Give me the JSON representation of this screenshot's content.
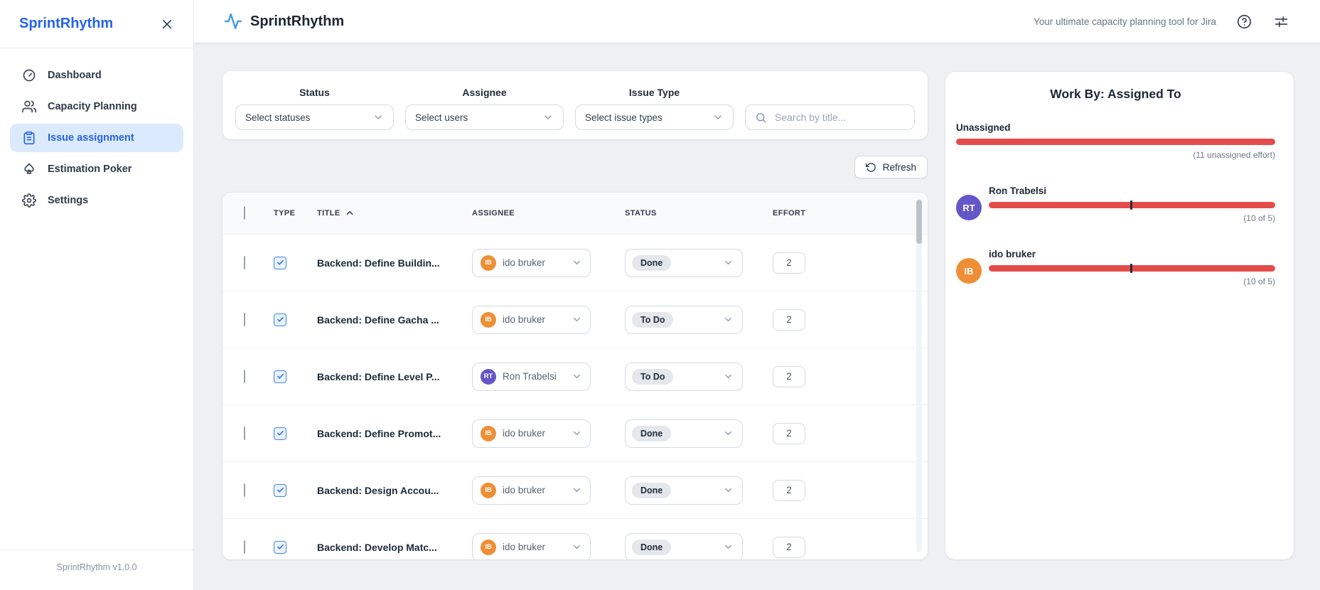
{
  "sidebar": {
    "title": "SprintRhythm",
    "items": [
      {
        "label": "Dashboard",
        "icon": "gauge-icon",
        "active": false
      },
      {
        "label": "Capacity Planning",
        "icon": "users-icon",
        "active": false
      },
      {
        "label": "Issue assignment",
        "icon": "clipboard-icon",
        "active": true
      },
      {
        "label": "Estimation Poker",
        "icon": "spade-icon",
        "active": false
      },
      {
        "label": "Settings",
        "icon": "gear-icon",
        "active": false
      }
    ],
    "footer": "SprintRhythm v1.0.0"
  },
  "topbar": {
    "brand": "SprintRhythm",
    "tagline": "Your ultimate capacity planning tool for Jira"
  },
  "filters": {
    "status_label": "Status",
    "status_value": "Select statuses",
    "assignee_label": "Assignee",
    "assignee_value": "Select users",
    "issue_type_label": "Issue Type",
    "issue_type_value": "Select issue types",
    "search_placeholder": "Search by title..."
  },
  "toolbar": {
    "refresh_label": "Refresh"
  },
  "table": {
    "headers": {
      "type": "TYPE",
      "title": "TITLE",
      "assignee": "ASSIGNEE",
      "status": "STATUS",
      "effort": "EFFORT"
    },
    "sort_column": "TITLE",
    "sort_direction": "ascending",
    "rows": [
      {
        "title": "Backend: Define Buildin...",
        "assignee": "ido bruker",
        "assignee_initials": "IB",
        "avatar_color": "#ee8f35",
        "status": "Done",
        "effort": "2"
      },
      {
        "title": "Backend: Define Gacha ...",
        "assignee": "ido bruker",
        "assignee_initials": "IB",
        "avatar_color": "#ee8f35",
        "status": "To Do",
        "effort": "2"
      },
      {
        "title": "Backend: Define Level P...",
        "assignee": "Ron Trabelsi",
        "assignee_initials": "RT",
        "avatar_color": "#6456c8",
        "status": "To Do",
        "effort": "2"
      },
      {
        "title": "Backend: Define Promot...",
        "assignee": "ido bruker",
        "assignee_initials": "IB",
        "avatar_color": "#ee8f35",
        "status": "Done",
        "effort": "2"
      },
      {
        "title": "Backend: Design Accou...",
        "assignee": "ido bruker",
        "assignee_initials": "IB",
        "avatar_color": "#ee8f35",
        "status": "Done",
        "effort": "2"
      },
      {
        "title": "Backend: Develop Matc...",
        "assignee": "ido bruker",
        "assignee_initials": "IB",
        "avatar_color": "#ee8f35",
        "status": "Done",
        "effort": "2"
      }
    ]
  },
  "work_by": {
    "title": "Work By: Assigned To",
    "bar_color": "#e44c4c",
    "unassigned_label": "Unassigned",
    "unassigned_caption": "(11 unassigned effort)",
    "people": [
      {
        "name": "Ron Trabelsi",
        "initials": "RT",
        "avatar_color": "#6456c8",
        "caption": "(10 of 5)",
        "marker_left": "49.5%"
      },
      {
        "name": "ido bruker",
        "initials": "IB",
        "avatar_color": "#ee8f35",
        "caption": "(10 of 5)",
        "marker_left": "49.5%"
      }
    ]
  },
  "colors": {
    "accent_blue": "#2563eb",
    "active_nav_bg": "#dbeafe",
    "overload_red": "#e44c4c",
    "avatar_orange": "#ee8f35",
    "avatar_purple": "#6456c8",
    "status_pill_gray": "#e4e7ec",
    "logo_pulse_blue": "#4aa0e2"
  }
}
